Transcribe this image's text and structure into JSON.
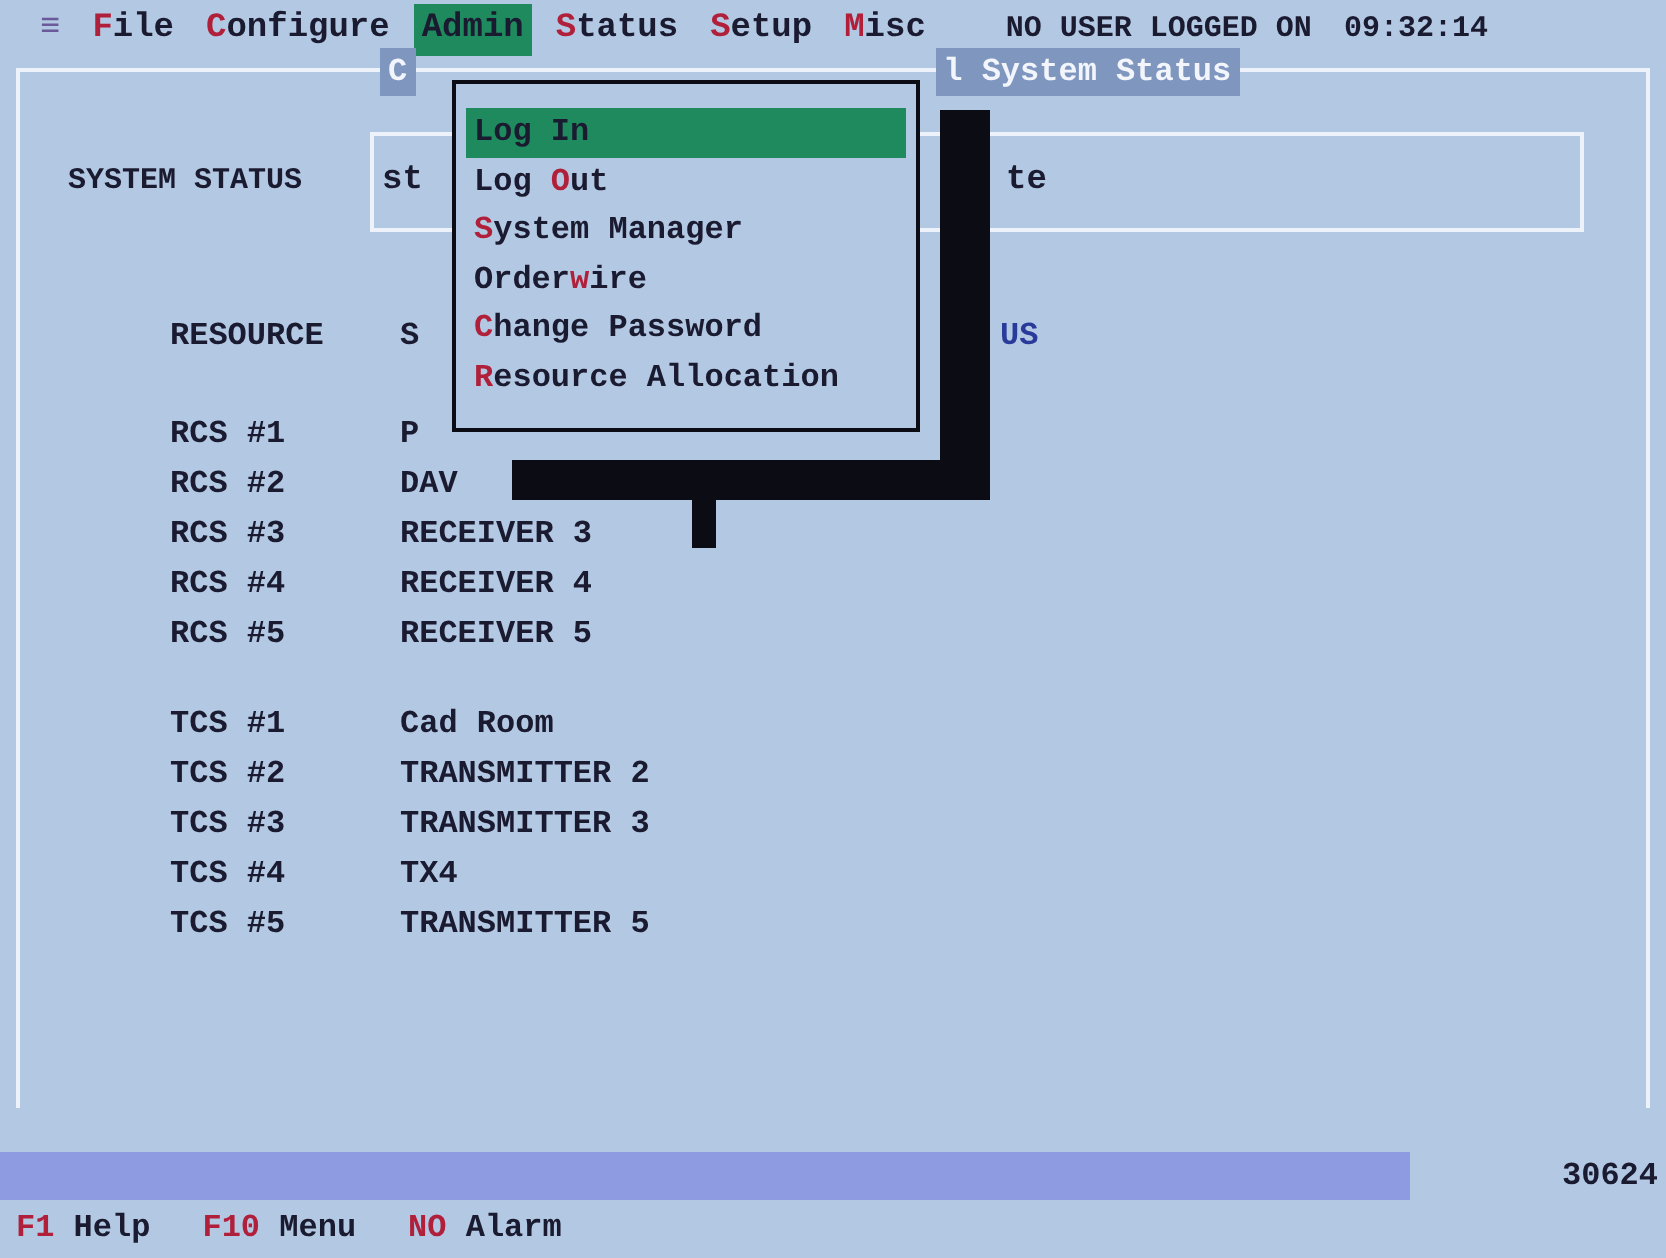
{
  "menu_bar": {
    "icon_text": "≡",
    "items": [
      {
        "key": "F",
        "post": "ile",
        "selected": false
      },
      {
        "key": "C",
        "post": "onfigure",
        "selected": false
      },
      {
        "key": "A",
        "post": "dmin",
        "selected": true
      },
      {
        "key": "S",
        "post": "tatus",
        "selected": false
      },
      {
        "key": "S",
        "post": "etup",
        "selected": false
      },
      {
        "key": "M",
        "post": "isc",
        "selected": false
      }
    ],
    "user": "NO USER LOGGED ON",
    "clock": "09:32:14"
  },
  "window": {
    "title_left": "C",
    "title_right": "l System Status"
  },
  "system_status": {
    "label": "SYSTEM STATUS",
    "value_left": "st",
    "value_right": "te"
  },
  "resources": {
    "header_1": "RESOURCE",
    "header_2": "S",
    "header_3": "US",
    "groups": [
      [
        {
          "name": "RCS #1",
          "value": "P"
        },
        {
          "name": "RCS #2",
          "value": "DAV"
        },
        {
          "name": "RCS #3",
          "value": "RECEIVER 3"
        },
        {
          "name": "RCS #4",
          "value": "RECEIVER 4"
        },
        {
          "name": "RCS #5",
          "value": "RECEIVER 5"
        }
      ],
      [
        {
          "name": "TCS #1",
          "value": "Cad Room"
        },
        {
          "name": "TCS #2",
          "value": "TRANSMITTER 2"
        },
        {
          "name": "TCS #3",
          "value": "TRANSMITTER 3"
        },
        {
          "name": "TCS #4",
          "value": "TX4"
        },
        {
          "name": "TCS #5",
          "value": "TRANSMITTER 5"
        }
      ]
    ]
  },
  "dropdown": {
    "items": [
      {
        "pre": "Log ",
        "key": "I",
        "post": "n",
        "selected": true
      },
      {
        "pre": "Log ",
        "key": "O",
        "post": "ut",
        "selected": false
      },
      {
        "key": "S",
        "post": "ystem Manager",
        "selected": false
      },
      {
        "pre": "Order",
        "key": "w",
        "post": "ire",
        "selected": false
      },
      {
        "key": "C",
        "post": "hange Password",
        "selected": false
      },
      {
        "key": "R",
        "post": "esource Allocation",
        "selected": false
      }
    ]
  },
  "status_bar": {
    "count": "30624",
    "keys": [
      {
        "key": "F1",
        "label": "Help"
      },
      {
        "key": "F10",
        "label": "Menu"
      },
      {
        "key": "NO",
        "label": "Alarm"
      }
    ]
  }
}
